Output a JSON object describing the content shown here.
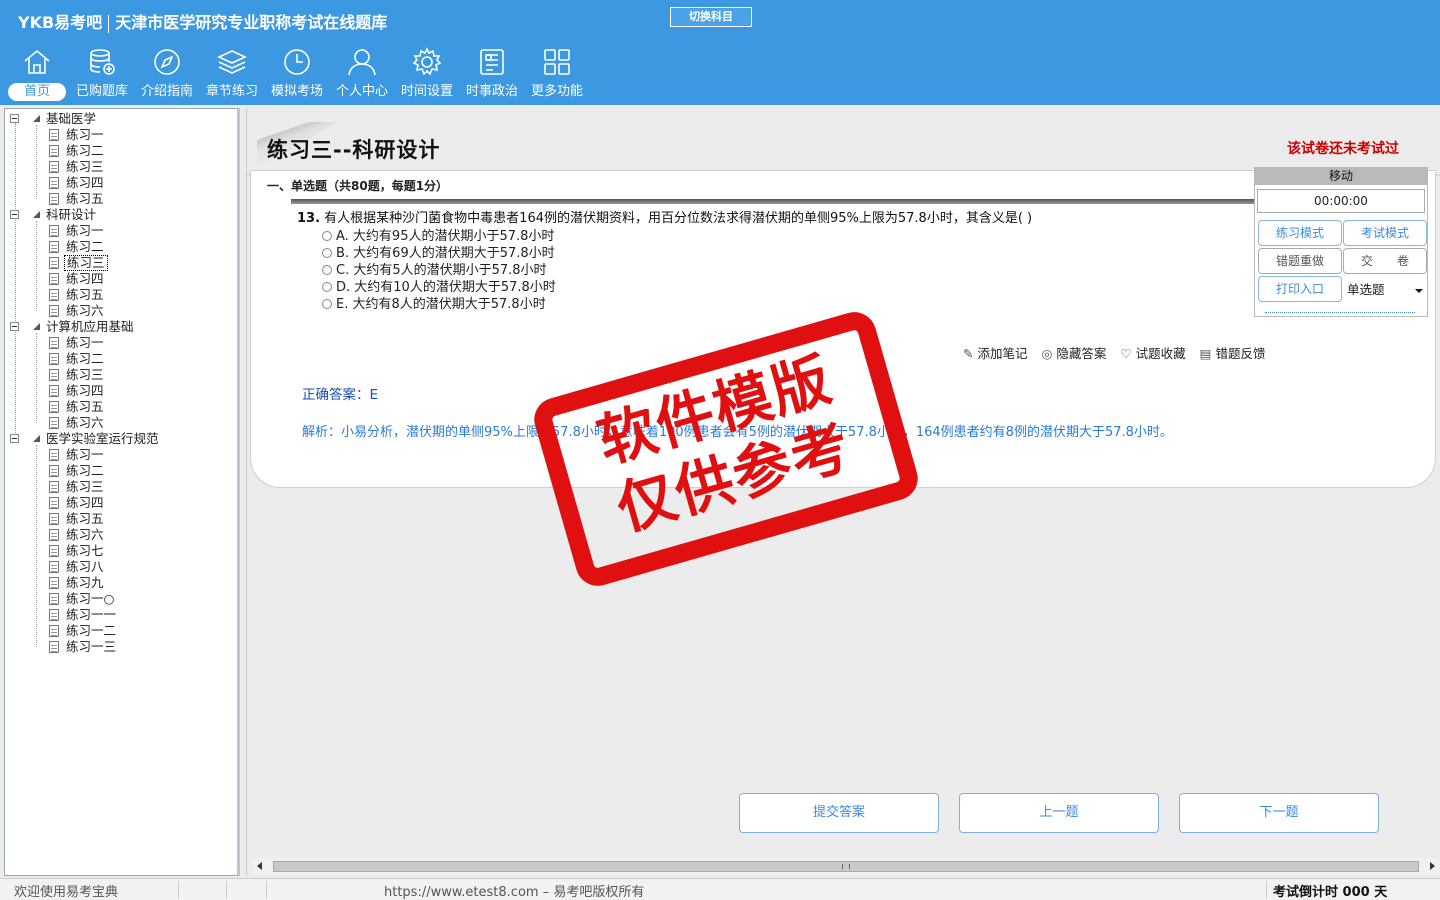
{
  "header": {
    "brand": "YKB易考吧",
    "app_title": "天津市医学研究专业职称考试在线题库",
    "switch_subject": "切换科目"
  },
  "nav": [
    {
      "label": "首页",
      "icon": "home-icon"
    },
    {
      "label": "已购题库",
      "icon": "database-icon"
    },
    {
      "label": "介绍指南",
      "icon": "compass-icon"
    },
    {
      "label": "章节练习",
      "icon": "layers-icon"
    },
    {
      "label": "模拟考场",
      "icon": "clock-icon"
    },
    {
      "label": "个人中心",
      "icon": "user-icon"
    },
    {
      "label": "时间设置",
      "icon": "gear-icon"
    },
    {
      "label": "时事政治",
      "icon": "news-icon"
    },
    {
      "label": "更多功能",
      "icon": "grid-icon"
    }
  ],
  "tree": {
    "categories": [
      {
        "label": "基础医学",
        "items": [
          "练习一",
          "练习二",
          "练习三",
          "练习四",
          "练习五"
        ]
      },
      {
        "label": "科研设计",
        "items": [
          "练习一",
          "练习二",
          "练习三",
          "练习四",
          "练习五",
          "练习六"
        ]
      },
      {
        "label": "计算机应用基础",
        "items": [
          "练习一",
          "练习二",
          "练习三",
          "练习四",
          "练习五",
          "练习六"
        ]
      },
      {
        "label": "医学实验室运行规范",
        "items": [
          "练习一",
          "练习二",
          "练习三",
          "练习四",
          "练习五",
          "练习六",
          "练习七",
          "练习八",
          "练习九",
          "练习一○",
          "练习一一",
          "练习一二",
          "练习一三"
        ]
      }
    ],
    "selected": "科研设计/练习三"
  },
  "main": {
    "title": "练习三--科研设计",
    "exam_status": "该试卷还未考试过",
    "section_header": "一、单选题（共80题，每题1分）",
    "question_number": "13.",
    "question_text": "有人根据某种沙门菌食物中毒患者164例的潜伏期资料，用百分位数法求得潜伏期的单侧95%上限为57.8小时，其含义是(  )",
    "options": [
      "A. 大约有95人的潜伏期小于57.8小时",
      "B. 大约有69人的潜伏期大于57.8小时",
      "C. 大约有5人的潜伏期小于57.8小时",
      "D. 大约有10人的潜伏期大于57.8小时",
      "E. 大约有8人的潜伏期大于57.8小时"
    ],
    "tools": {
      "add_note": "添加笔记",
      "hide_answer": "隐藏答案",
      "favorite": "试题收藏",
      "feedback": "错题反馈"
    },
    "answer": "正确答案：E",
    "analysis": "解析：小易分析，潜伏期的单侧95%上限为57.8小时，意味着100例患者会有5例的潜伏期大于57.8小时，164例患者约有8例的潜伏期大于57.8小时。",
    "buttons": {
      "submit": "提交答案",
      "prev": "上一题",
      "next": "下一题"
    }
  },
  "control_panel": {
    "title": "移动",
    "timer": "00:00:00",
    "practice_mode": "练习模式",
    "exam_mode": "考试模式",
    "redo_wrong": "错题重做",
    "submit_paper": "交　　卷",
    "print": "打印入口",
    "question_type": "单选题"
  },
  "stamp": {
    "line1": "软件模版",
    "line2": "仅供参考"
  },
  "status": {
    "welcome": "欢迎使用易考宝典",
    "copyright": "https://www.etest8.com – 易考吧版权所有",
    "countdown": "考试倒计时 000 天"
  },
  "colors": {
    "header_bg": "#3c98e0",
    "accent": "#3a8be0",
    "status_red": "#cc0000",
    "stamp_red": "#e01010"
  }
}
